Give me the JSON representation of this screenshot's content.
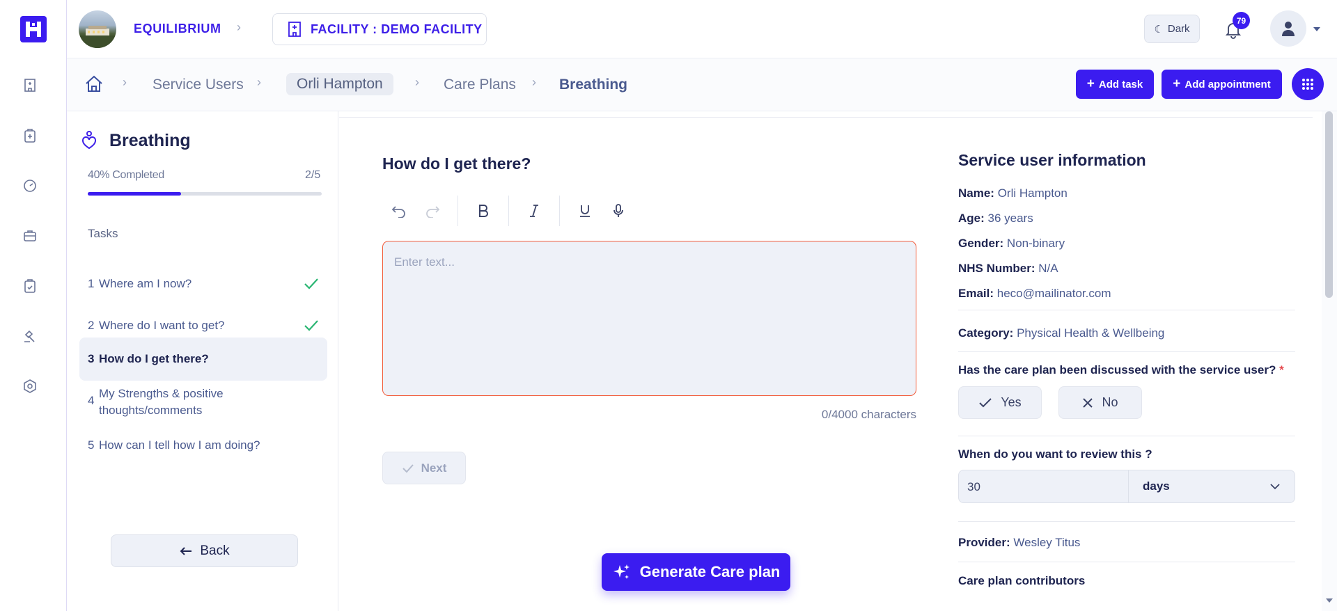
{
  "header": {
    "org_name": "EQUILIBRIUM",
    "facility_label": "FACILITY : DEMO FACILITY",
    "theme_label": "Dark",
    "notification_count": "79"
  },
  "breadcrumb": {
    "items": [
      "Service Users",
      "Orli Hampton",
      "Care Plans",
      "Breathing"
    ]
  },
  "actions": {
    "add_task": "Add task",
    "add_appointment": "Add appointment"
  },
  "task_panel": {
    "title": "Breathing",
    "progress_label": "40% Completed",
    "progress_count": "2/5",
    "progress_fraction": 0.4,
    "tasks_heading": "Tasks",
    "tasks": [
      {
        "num": "1",
        "label": "Where am I now?",
        "done": true
      },
      {
        "num": "2",
        "label": "Where do I want to get?",
        "done": true
      },
      {
        "num": "3",
        "label": "How do I get there?",
        "done": false,
        "active": true
      },
      {
        "num": "4",
        "label": "My Strengths & positive thoughts/comments",
        "done": false
      },
      {
        "num": "5",
        "label": "How can I tell how I am doing?",
        "done": false
      }
    ],
    "back_label": "Back"
  },
  "editor": {
    "question": "How do I get there?",
    "placeholder": "Enter text...",
    "char_count": "0/4000 characters",
    "next_label": "Next",
    "generate_label": "Generate Care plan"
  },
  "info": {
    "title": "Service user information",
    "name_label": "Name:",
    "name": "Orli Hampton",
    "age_label": "Age:",
    "age": "36 years",
    "gender_label": "Gender:",
    "gender": "Non-binary",
    "nhs_label": "NHS Number:",
    "nhs": "N/A",
    "email_label": "Email:",
    "email": "heco@mailinator.com",
    "category_label": "Category:",
    "category": "Physical Health & Wellbeing",
    "discussed_question": "Has the care plan been discussed with the service user?",
    "required_mark": "*",
    "yes_label": "Yes",
    "no_label": "No",
    "review_question": "When do you want to review this ?",
    "review_value": "30",
    "review_unit": "days",
    "provider_label": "Provider:",
    "provider": "Wesley Titus",
    "contributors_label": "Care plan contributors"
  },
  "colors": {
    "brand": "#3b1cf0",
    "success": "#2bb673",
    "error_border": "#f25c3b"
  }
}
